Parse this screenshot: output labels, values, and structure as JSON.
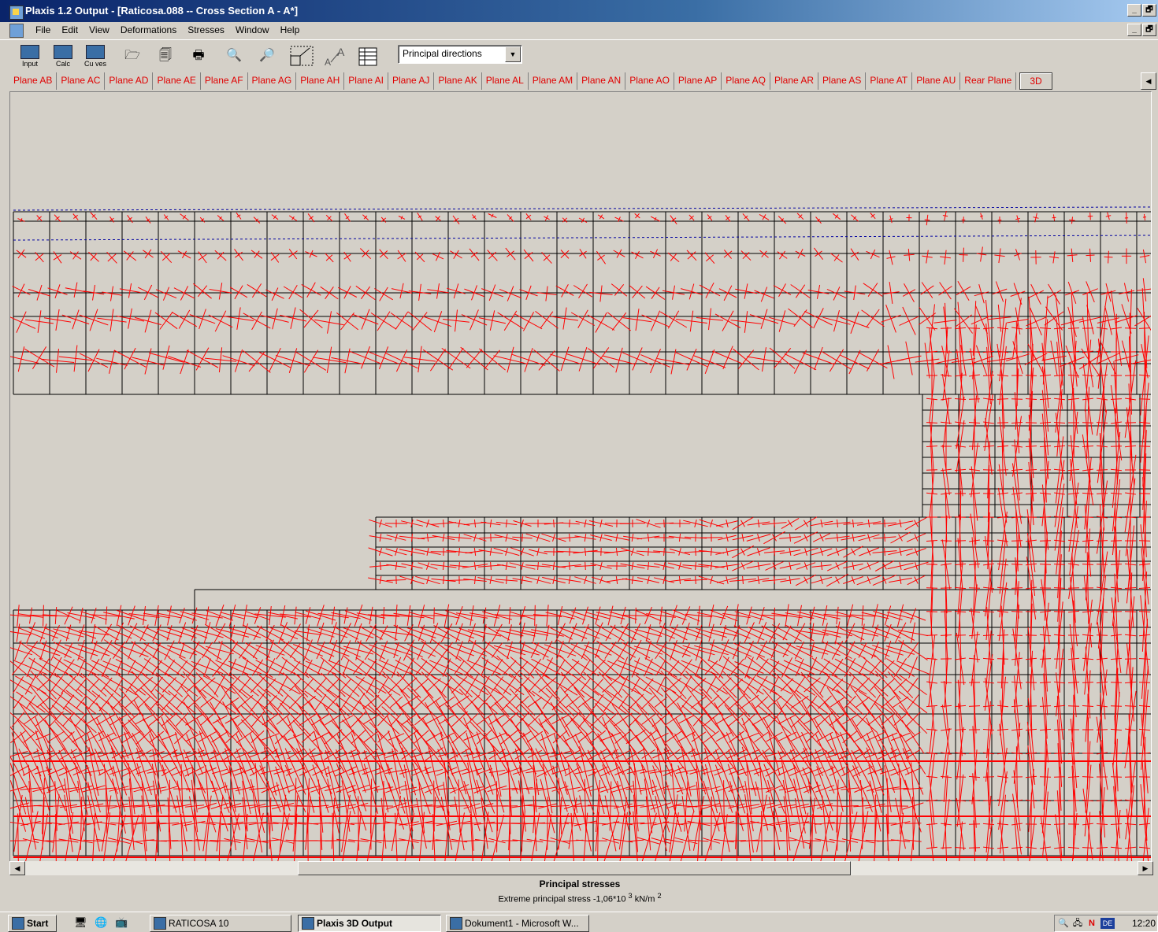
{
  "window": {
    "title": "Plaxis 1.2 Output - [Raticosa.088  --  Cross Section A - A*]",
    "controls": [
      "_",
      "🗗"
    ]
  },
  "menu": {
    "items": [
      "File",
      "Edit",
      "View",
      "Deformations",
      "Stresses",
      "Window",
      "Help"
    ]
  },
  "toolbar": {
    "input_label": "Input",
    "calc_label": "Calc",
    "curves_label": "Cu ves",
    "result_select": {
      "value": "Principal directions"
    }
  },
  "planes": {
    "tabs": [
      "Plane AB",
      "Plane AC",
      "Plane AD",
      "Plane AE",
      "Plane AF",
      "Plane AG",
      "Plane AH",
      "Plane AI",
      "Plane AJ",
      "Plane AK",
      "Plane AL",
      "Plane AM",
      "Plane AN",
      "Plane AO",
      "Plane AP",
      "Plane AQ",
      "Plane AR",
      "Plane AS",
      "Plane AT",
      "Plane AU",
      "Rear Plane"
    ],
    "active": "3D"
  },
  "caption": {
    "title": "Principal stresses",
    "subtitle": "Extreme principal stress -1,06*10",
    "exp1": "3",
    "unit": " kN/m",
    "exp2": "2"
  },
  "taskbar": {
    "start": "Start",
    "buttons": [
      {
        "label": "RATICOSA  10",
        "pressed": false
      },
      {
        "label": "Plaxis 3D Output",
        "pressed": true
      },
      {
        "label": "Dokument1 - Microsoft W...",
        "pressed": false
      }
    ],
    "lang": "DE",
    "clock": "12:20"
  },
  "colors": {
    "stress": "#ff0000",
    "mesh": "#000000",
    "groundwater": "#0000a0"
  }
}
